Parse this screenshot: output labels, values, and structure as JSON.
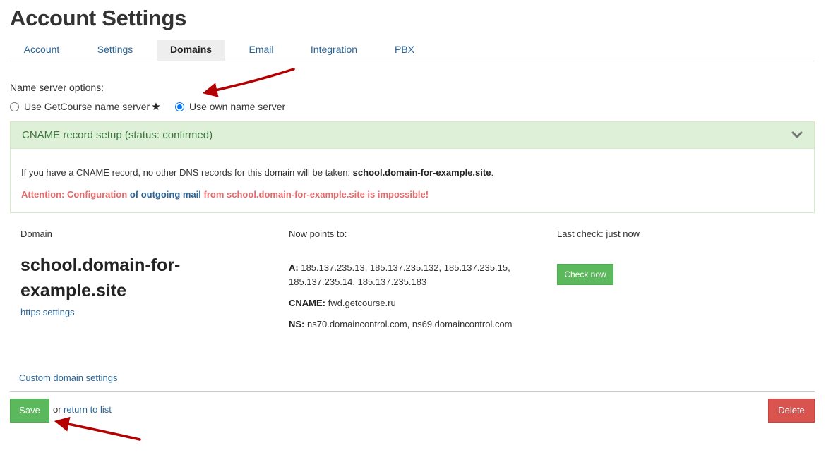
{
  "page": {
    "title": "Account Settings"
  },
  "tabs": [
    {
      "label": "Account",
      "active": false
    },
    {
      "label": "Settings",
      "active": false
    },
    {
      "label": "Domains",
      "active": true
    },
    {
      "label": "Email",
      "active": false
    },
    {
      "label": "Integration",
      "active": false
    },
    {
      "label": "PBX",
      "active": false
    }
  ],
  "name_server": {
    "label": "Name server options:",
    "options": [
      {
        "label": "Use GetCourse name server",
        "checked": false,
        "suffix": "★"
      },
      {
        "label": "Use own name server",
        "checked": true
      }
    ]
  },
  "cname_panel": {
    "title": "CNAME record setup (status: confirmed)",
    "text_prefix": "If you have a CNAME record, no other DNS records for this domain will be taken:",
    "text_domain": "school.domain-for-example.site",
    "text_suffix": ".",
    "attention_prefix": "Attention: Configuration",
    "attention_link": "of outgoing mail",
    "attention_suffix": "from school.domain-for-example.site is impossible!"
  },
  "domain_info": {
    "domain_header": "Domain",
    "points_header": "Now points to:",
    "last_check": "Last check: just now",
    "domain_line1": "school.domain-for-",
    "domain_line2": "example.site",
    "https_link": "https settings",
    "a_label": "A:",
    "a_line1": "185.137.235.13, 185.137.235.132, 185.137.235.15,",
    "a_line2": "185.137.235.14, 185.137.235.183",
    "cname_label": "CNAME:",
    "cname_value": "fwd.getcourse.ru",
    "ns_label": "NS:",
    "ns_value": "ns70.domaincontrol.com, ns69.domaincontrol.com",
    "check_button": "Check now"
  },
  "footer": {
    "custom_link": "Custom domain settings",
    "save_button": "Save",
    "or_text": "or",
    "return_link": "return to list",
    "delete_button": "Delete"
  },
  "colors": {
    "success": "#5cb85c",
    "danger": "#d9534f",
    "link": "#2a6496",
    "panel_bg": "#dff0d8",
    "panel_text": "#3c763d",
    "attention": "#e66a6a",
    "annotation_arrow": "#b30000"
  }
}
